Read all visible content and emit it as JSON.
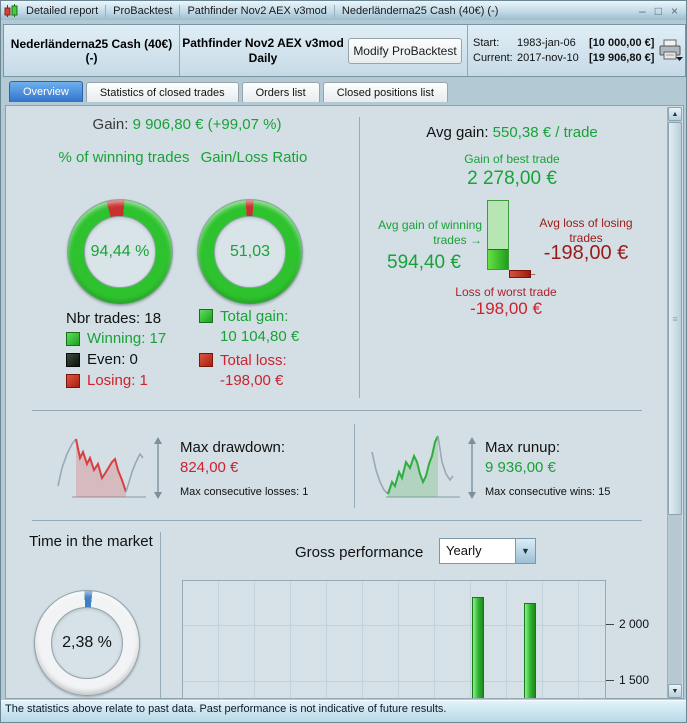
{
  "window": {
    "title_parts": [
      "Detailed report",
      "ProBacktest",
      "Pathfinder Nov2 AEX v3mod",
      "Nederländerna25 Cash (40€) (-)"
    ],
    "controls": {
      "minimize": "–",
      "maximize": "□",
      "close": "×"
    }
  },
  "header": {
    "instrument": "Nederländerna25 Cash (40€) (-)",
    "strategy": "Pathfinder Nov2 AEX v3mod",
    "timeframe": "Daily",
    "modify_button": "Modify ProBacktest",
    "start_label": "Start:",
    "start_date": "1983-jan-06",
    "start_value": "[10 000,00 €]",
    "current_label": "Current:",
    "current_date": "2017-nov-10",
    "current_value": "[19 906,80 €]"
  },
  "tabs": [
    {
      "label": "Overview",
      "active": true
    },
    {
      "label": "Statistics of closed trades",
      "active": false
    },
    {
      "label": "Orders list",
      "active": false
    },
    {
      "label": "Closed positions list",
      "active": false
    }
  ],
  "overview": {
    "gain_label": "Gain:",
    "gain_value": "9 906,80 € (+99,07 %)",
    "winning_gauge": {
      "title": "% of winning trades",
      "value": "94,44 %",
      "slice_from": -15,
      "slice_deg": 20,
      "slice_color": "#c93030",
      "ring_color": "#2ec32e"
    },
    "ratio_gauge": {
      "title": "Gain/Loss Ratio",
      "value": "51,03",
      "slice_from": -5,
      "slice_deg": 9,
      "slice_color": "#c93030",
      "ring_color": "#2ec32e"
    },
    "trades": {
      "nbr": "Nbr trades: 18",
      "winning": "Winning: 17",
      "even": "Even: 0",
      "losing": "Losing: 1"
    },
    "totals": {
      "gain_label": "Total gain:",
      "gain_value": "10 104,80 €",
      "loss_label": "Total loss:",
      "loss_value": "-198,00 €"
    },
    "avg": {
      "label": "Avg gain:",
      "value": "550,38 € / trade",
      "best_label": "Gain of best trade",
      "best_value": "2 278,00 €",
      "win_label": "Avg gain of winning trades",
      "win_value": "594,40 €",
      "loss_label": "Avg loss of losing trades",
      "loss_value": "-198,00 €",
      "worst_label": "Loss of worst trade",
      "worst_value": "-198,00 €"
    },
    "drawdown": {
      "label": "Max drawdown:",
      "value": "824,00 €",
      "consec": "Max consecutive losses: 1"
    },
    "runup": {
      "label": "Max runup:",
      "value": "9 936,00 €",
      "consec": "Max consecutive wins: 15"
    },
    "time_in_market": {
      "title": "Time in the market",
      "value": "2,38 %",
      "slice_from": -3,
      "slice_deg": 9,
      "slice_color": "#3f7fc4",
      "ring_color": "#f1f3f4"
    },
    "gross_performance": {
      "label": "Gross performance",
      "period": "Yearly"
    }
  },
  "chart_data": {
    "type": "bar",
    "title": "Gross performance",
    "period": "Yearly",
    "y_visible_range": [
      1351,
      2386
    ],
    "y_ticks": [
      {
        "value": 2000,
        "label": "2 000"
      },
      {
        "value": 1500,
        "label": "1 500"
      }
    ],
    "bars": [
      {
        "x_frac": 0.684,
        "value": 2246
      },
      {
        "x_frac": 0.807,
        "value": 2193
      }
    ],
    "bar_color": "#2ec32e",
    "grid": true,
    "legend": "none"
  },
  "icons": {
    "arrow_right": "→",
    "arrow_left": "←",
    "dropdown_arrow": "▼",
    "scroll_up": "▲",
    "scroll_down": "▼",
    "thumb_grip": "≡"
  },
  "status_bar": {
    "text": "The statistics above relate to past data. Past performance is not indicative of future results."
  }
}
